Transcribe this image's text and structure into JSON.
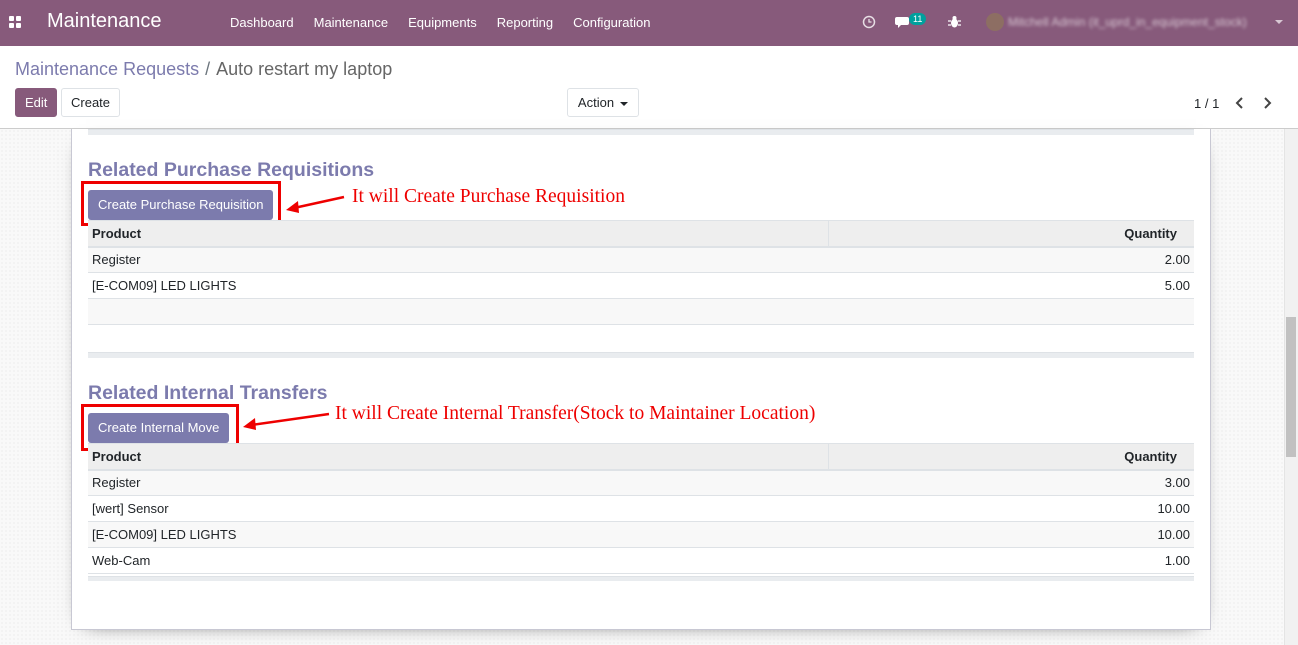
{
  "navbar": {
    "app_title": "Maintenance",
    "menu": [
      "Dashboard",
      "Maintenance",
      "Equipments",
      "Reporting",
      "Configuration"
    ],
    "messages_count": "11",
    "user_name": "Mitchell Admin (it_uprd_in_equipment_stock)",
    "bg_color": "#875a7b"
  },
  "breadcrumb": {
    "parent": "Maintenance Requests",
    "separator": "/",
    "current": "Auto restart my laptop"
  },
  "buttons": {
    "edit": "Edit",
    "create": "Create",
    "action": "Action"
  },
  "pager": {
    "value": "1 / 1"
  },
  "purchase_section": {
    "title": "Related Purchase Requisitions",
    "button": "Create Purchase Requisition",
    "annotation": "It will Create Purchase Requisition",
    "columns": [
      "Product",
      "Quantity"
    ],
    "rows": [
      {
        "product": "Register",
        "quantity": "2.00"
      },
      {
        "product": "[E-COM09] LED LIGHTS",
        "quantity": "5.00"
      }
    ]
  },
  "internal_section": {
    "title": "Related Internal Transfers",
    "button": "Create Internal Move",
    "annotation": "It will Create Internal Transfer(Stock to Maintainer Location)",
    "columns": [
      "Product",
      "Quantity"
    ],
    "rows": [
      {
        "product": "Register",
        "quantity": "3.00"
      },
      {
        "product": "[wert] Sensor",
        "quantity": "10.00"
      },
      {
        "product": "[E-COM09] LED LIGHTS",
        "quantity": "10.00"
      },
      {
        "product": "Web-Cam",
        "quantity": "1.00"
      }
    ]
  },
  "colors": {
    "accent": "#7c7bad",
    "annotation_red": "#e00000"
  }
}
